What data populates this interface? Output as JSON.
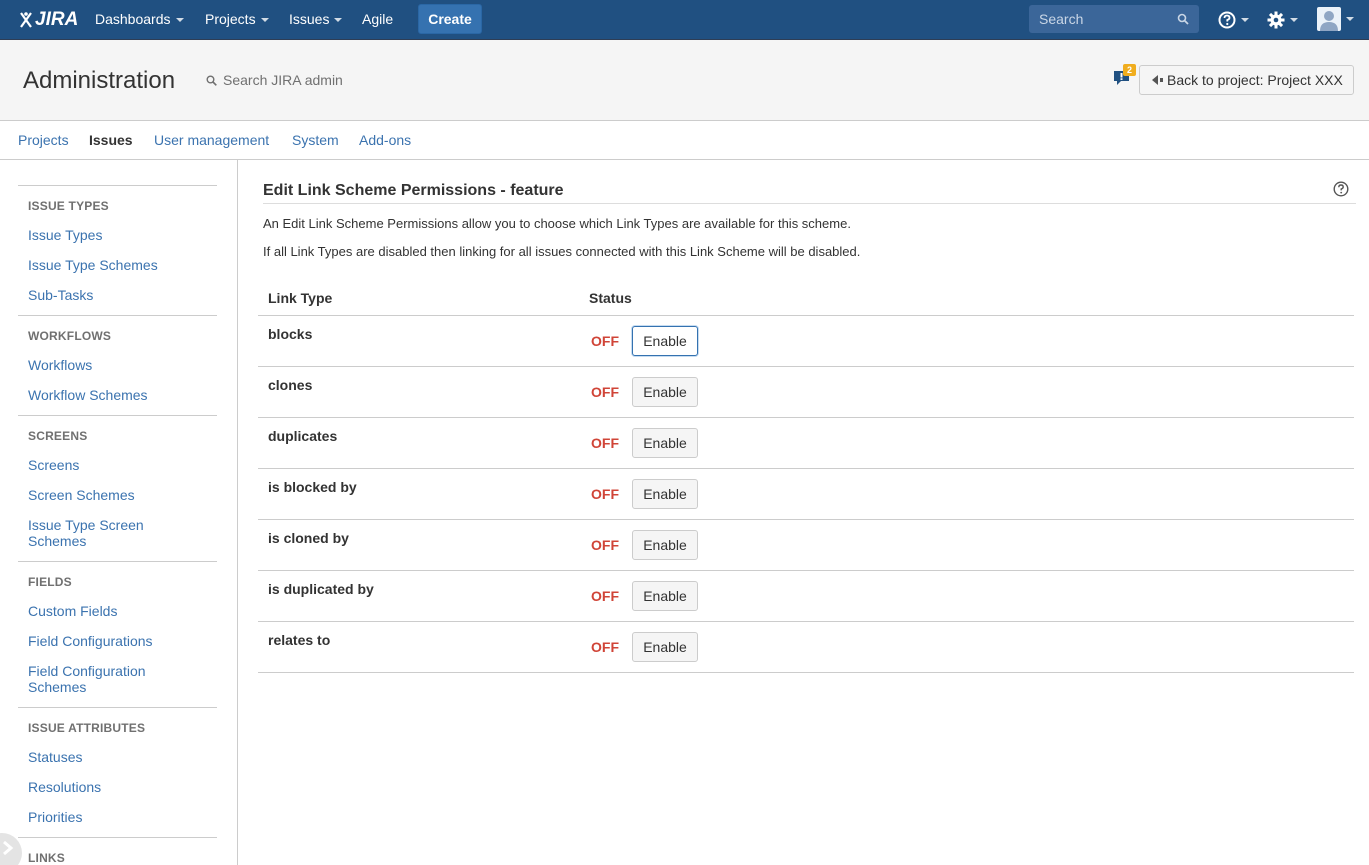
{
  "topnav": {
    "logo": "JIRA",
    "items": [
      {
        "label": "Dashboards",
        "dropdown": true
      },
      {
        "label": "Projects",
        "dropdown": true
      },
      {
        "label": "Issues",
        "dropdown": true
      },
      {
        "label": "Agile",
        "dropdown": false
      }
    ],
    "create_label": "Create",
    "search_placeholder": "Search",
    "colors": {
      "bar": "#205081",
      "create": "#3572b0"
    }
  },
  "admin_header": {
    "title": "Administration",
    "search_label": "Search JIRA admin",
    "notification_count": "2",
    "back_label": "Back to project: Project XXX"
  },
  "tabs": [
    {
      "label": "Projects",
      "active": false
    },
    {
      "label": "Issues",
      "active": true
    },
    {
      "label": "User management",
      "active": false
    },
    {
      "label": "System",
      "active": false
    },
    {
      "label": "Add-ons",
      "active": false
    }
  ],
  "sidebar": {
    "sections": [
      {
        "title": "ISSUE TYPES",
        "links": [
          "Issue Types",
          "Issue Type Schemes",
          "Sub-Tasks"
        ]
      },
      {
        "title": "WORKFLOWS",
        "links": [
          "Workflows",
          "Workflow Schemes"
        ]
      },
      {
        "title": "SCREENS",
        "links": [
          "Screens",
          "Screen Schemes",
          "Issue Type Screen Schemes"
        ]
      },
      {
        "title": "FIELDS",
        "links": [
          "Custom Fields",
          "Field Configurations",
          "Field Configuration Schemes"
        ]
      },
      {
        "title": "ISSUE ATTRIBUTES",
        "links": [
          "Statuses",
          "Resolutions",
          "Priorities"
        ]
      },
      {
        "title": "LINKS",
        "links": []
      }
    ]
  },
  "main": {
    "title": "Edit Link Scheme Permissions - feature",
    "desc1": "An Edit Link Scheme Permissions allow you to choose which Link Types are available for this scheme.",
    "desc2": "If all Link Types are disabled then linking for all issues connected with this Link Scheme will be disabled.",
    "table": {
      "headers": [
        "Link Type",
        "Status"
      ],
      "rows": [
        {
          "link_type": "blocks",
          "status": "OFF",
          "action": "Enable"
        },
        {
          "link_type": "clones",
          "status": "OFF",
          "action": "Enable"
        },
        {
          "link_type": "duplicates",
          "status": "OFF",
          "action": "Enable"
        },
        {
          "link_type": "is blocked by",
          "status": "OFF",
          "action": "Enable"
        },
        {
          "link_type": "is cloned by",
          "status": "OFF",
          "action": "Enable"
        },
        {
          "link_type": "is duplicated by",
          "status": "OFF",
          "action": "Enable"
        },
        {
          "link_type": "relates to",
          "status": "OFF",
          "action": "Enable"
        }
      ]
    },
    "colors": {
      "status_off": "#d04437",
      "link": "#3b73af"
    }
  }
}
